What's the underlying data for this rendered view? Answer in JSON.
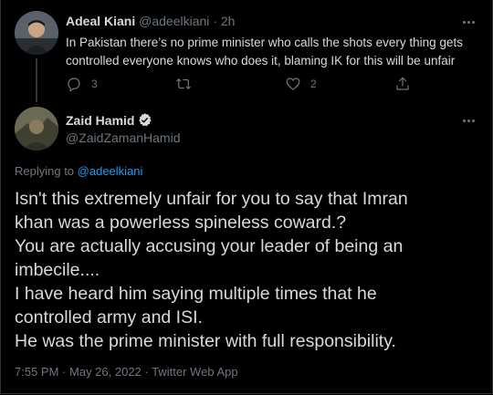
{
  "parent_tweet": {
    "author_name": "Adeal Kiani",
    "handle": "@adeelkiani",
    "separator": "·",
    "time_ago": "2h",
    "text": "In Pakistan there’s no prime minister who calls the shots every thing gets controlled everyone knows who does it, blaming IK for this will be unfair",
    "lines": [
      "In Pakistan there’s no prime minister who calls the shots every thing gets",
      "controlled everyone knows who does it, blaming IK for this will be unfair"
    ],
    "reply_count": "3",
    "retweet_count": "",
    "like_count": "2",
    "icons": [
      "reply-icon",
      "retweet-icon",
      "like-icon",
      "share-icon",
      "more-icon"
    ]
  },
  "main_tweet": {
    "author_name": "Zaid Hamid",
    "verified": true,
    "handle": "@ZaidZamanHamid",
    "replying_label": "Replying to",
    "replying_to": "@adeelkiani",
    "lines": [
      "Isn't this extremely unfair for you to say that Imran",
      "khan was a powerless spineless coward.?",
      "You are actually accusing your leader of being an",
      "imbecile....",
      "I have heard him saying multiple times that he",
      "controlled army and ISI.",
      "He was the prime minister with full responsibility."
    ],
    "time": "7:55 PM",
    "date": "May 26, 2022",
    "source": "Twitter Web App",
    "meta_separator": "·"
  },
  "colors": {
    "background": "#000000",
    "text": "#d9d9d9",
    "muted": "#6e767d",
    "link": "#1d9bf0",
    "border": "#2f3336"
  }
}
